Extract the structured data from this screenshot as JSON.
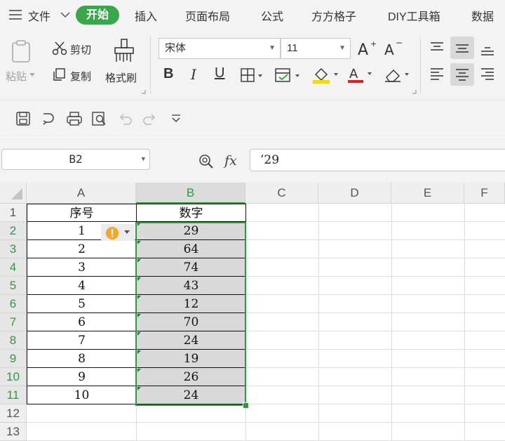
{
  "menu": {
    "file_label": "文件",
    "tabs": [
      "开始",
      "插入",
      "页面布局",
      "公式",
      "方方格子",
      "DIY工具箱",
      "数据"
    ]
  },
  "ribbon": {
    "paste_label": "粘贴",
    "cut_label": "剪切",
    "copy_label": "复制",
    "format_painter_label": "格式刷",
    "font_name": "宋体",
    "font_size": "11",
    "bold": "B",
    "italic": "I",
    "underline": "U"
  },
  "formula_bar": {
    "name_box": "B2",
    "fx_label": "fx",
    "formula": "’29"
  },
  "sheet": {
    "columns": [
      "A",
      "B",
      "C",
      "D",
      "E",
      "F"
    ],
    "rows": [
      "1",
      "2",
      "3",
      "4",
      "5",
      "6",
      "7",
      "8",
      "9",
      "10",
      "11",
      "12",
      "13"
    ],
    "header_a": "序号",
    "header_b": "数字",
    "col_a": [
      "1",
      "2",
      "3",
      "4",
      "5",
      "6",
      "7",
      "8",
      "9",
      "10"
    ],
    "col_b": [
      "29",
      "64",
      "74",
      "43",
      "12",
      "70",
      "24",
      "19",
      "26",
      "24"
    ],
    "active_column": "B",
    "selection": "B2:B11"
  },
  "colors": {
    "accent": "#3aa84a",
    "selection_border": "#2f9a3d",
    "selection_fill": "#d9d9d9",
    "warning": "#f5a623"
  }
}
